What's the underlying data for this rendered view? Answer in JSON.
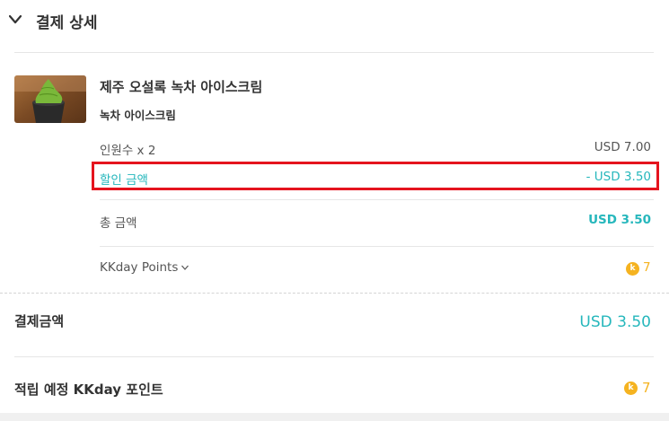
{
  "header": {
    "title": "결제 상세",
    "toggle_icon": "chevron-down-icon"
  },
  "product": {
    "name": "제주 오설록 녹차 아이스크림",
    "package": "녹차 아이스크림",
    "thumbnail": "green-tea-ice-cream-photo"
  },
  "rows": {
    "persons": {
      "label": "인원수 x 2",
      "value": "USD 7.00"
    },
    "discount": {
      "label": "할인 금액",
      "value": "- USD 3.50"
    },
    "total": {
      "label": "총 금액",
      "value": "USD 3.50"
    },
    "points": {
      "label": "KKday Points",
      "value": "7",
      "coin_letter": "k"
    }
  },
  "payment": {
    "title": "결제금액",
    "value": "USD 3.50"
  },
  "earn": {
    "title": "적립 예정 KKday 포인트",
    "value": "7",
    "coin_letter": "k"
  },
  "colors": {
    "accent": "#26b7bc",
    "coin": "#f5b320",
    "highlight": "#e5141e"
  }
}
